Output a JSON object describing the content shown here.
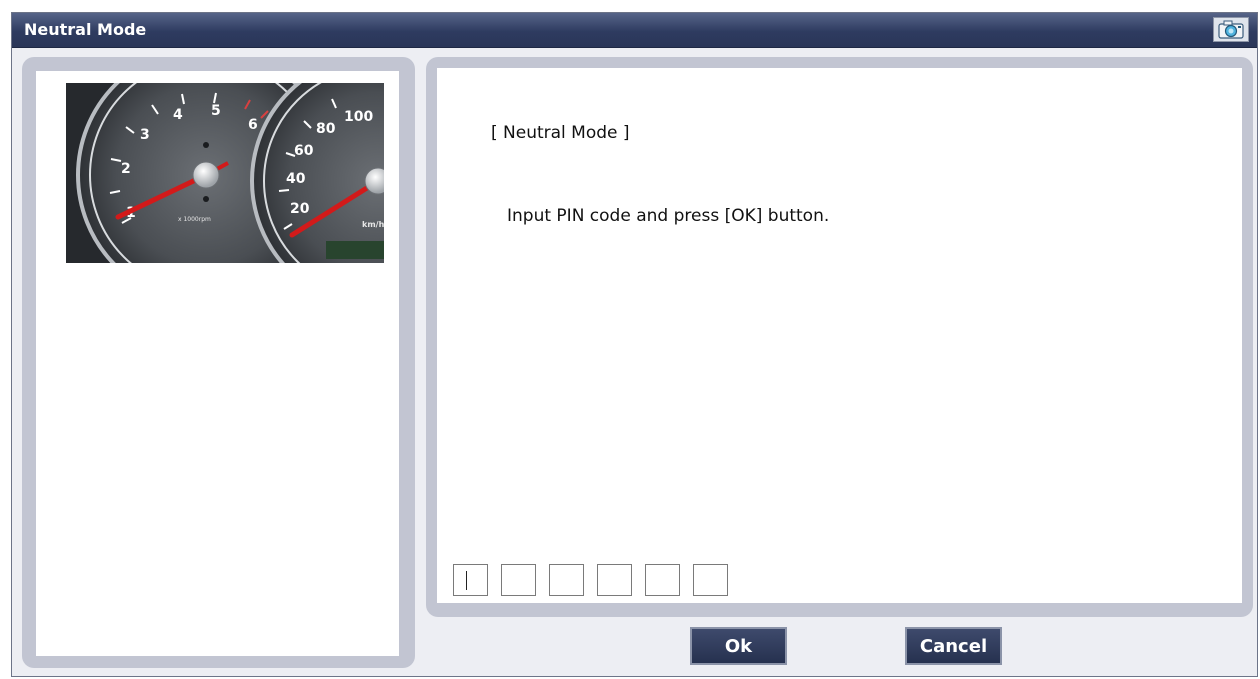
{
  "window": {
    "title": "Neutral Mode",
    "camera_icon": "camera-icon"
  },
  "gauge_image": {
    "tachometer_ticks": [
      "1",
      "2",
      "3",
      "4",
      "5",
      "6"
    ],
    "tachometer_unit": "x 1000rpm",
    "speedometer_ticks": [
      "20",
      "40",
      "60",
      "80",
      "100"
    ],
    "speedometer_unit": "km/h",
    "needle_color": "#d21a1a"
  },
  "content": {
    "heading": "[ Neutral Mode ]",
    "instruction": "Input PIN code and press [OK] button."
  },
  "pin": {
    "length": 6,
    "values": [
      "",
      "",
      "",
      "",
      "",
      ""
    ],
    "active_index": 0
  },
  "buttons": {
    "ok_label": "Ok",
    "cancel_label": "Cancel"
  },
  "colors": {
    "titlebar": "#2e3b60",
    "button": "#2c3757",
    "panel_border": "#c2c5d2"
  }
}
